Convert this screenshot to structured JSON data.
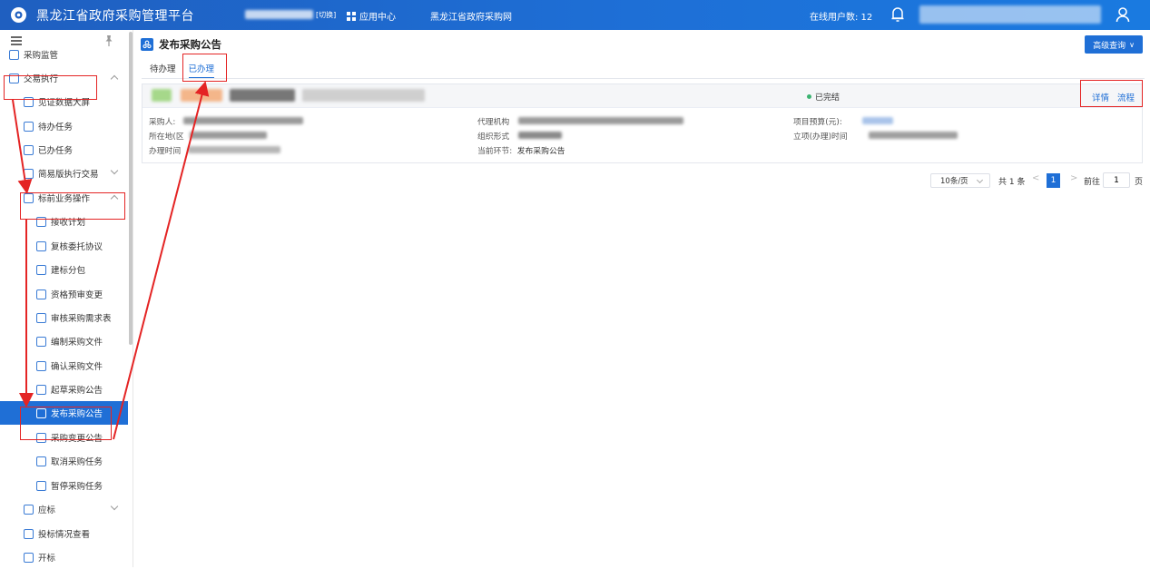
{
  "topbar": {
    "app_title": "黑龙江省政府采购管理平台",
    "switch_label": "[切换]",
    "app_center": "应用中心",
    "gov_link": "黑龙江省政府采购网",
    "online_users": "在线用户数: 12"
  },
  "sidebar": {
    "items": [
      {
        "label": "采购监管",
        "icon": "shield-icon"
      },
      {
        "label": "交易执行",
        "icon": "shield-check-icon"
      },
      {
        "label": "见证数据大屏",
        "icon": "dashboard-icon"
      },
      {
        "label": "待办任务",
        "icon": "task-icon"
      },
      {
        "label": "已办任务",
        "icon": "task-done-icon"
      },
      {
        "label": "简易版执行交易",
        "icon": "compass-icon"
      },
      {
        "label": "标前业务操作",
        "icon": "cart-icon"
      },
      {
        "label": "接收计划",
        "icon": "import-icon"
      },
      {
        "label": "复核委托协议",
        "icon": "doc-icon"
      },
      {
        "label": "建标分包",
        "icon": "edit-doc-icon"
      },
      {
        "label": "资格预审变更",
        "icon": "users-icon"
      },
      {
        "label": "审核采购需求表",
        "icon": "clipboard-icon"
      },
      {
        "label": "编制采购文件",
        "icon": "file-icon"
      },
      {
        "label": "确认采购文件",
        "icon": "file-check-icon"
      },
      {
        "label": "起草采购公告",
        "icon": "cart-icon"
      },
      {
        "label": "发布采购公告",
        "icon": "users-icon"
      },
      {
        "label": "采购变更公告",
        "icon": "list-icon"
      },
      {
        "label": "取消采购任务",
        "icon": "cancel-doc-icon"
      },
      {
        "label": "暂停采购任务",
        "icon": "pause-doc-icon"
      },
      {
        "label": "应标",
        "icon": "calendar-icon"
      },
      {
        "label": "投标情况查看",
        "icon": "search-doc-icon"
      },
      {
        "label": "开标",
        "icon": "gavel-icon"
      }
    ]
  },
  "main": {
    "page_title": "发布采购公告",
    "adv_search": "高级查询",
    "tabs": [
      "待办理",
      "已办理"
    ],
    "card": {
      "status": "已完结",
      "detail_link": "详情",
      "flow_link": "流程",
      "buyer_label": "采购人:",
      "region_label": "所在地(区",
      "time_label": "办理时间",
      "agency_label": "代理机构",
      "org_form_label": "组织形式",
      "stage_label": "当前环节:",
      "stage_value": "发布采购公告",
      "budget_label": "项目预算(元):",
      "setup_time_label": "立项(办理)时间"
    },
    "pagination": {
      "page_size": "10条/页",
      "total": "共 1 条",
      "current": "1",
      "goto_label": "前往",
      "goto_value": "1",
      "page_label": "页"
    }
  },
  "colors": {
    "brand": "#1f6fd6",
    "highlight": "#e42424",
    "status_done": "#3cb371"
  }
}
